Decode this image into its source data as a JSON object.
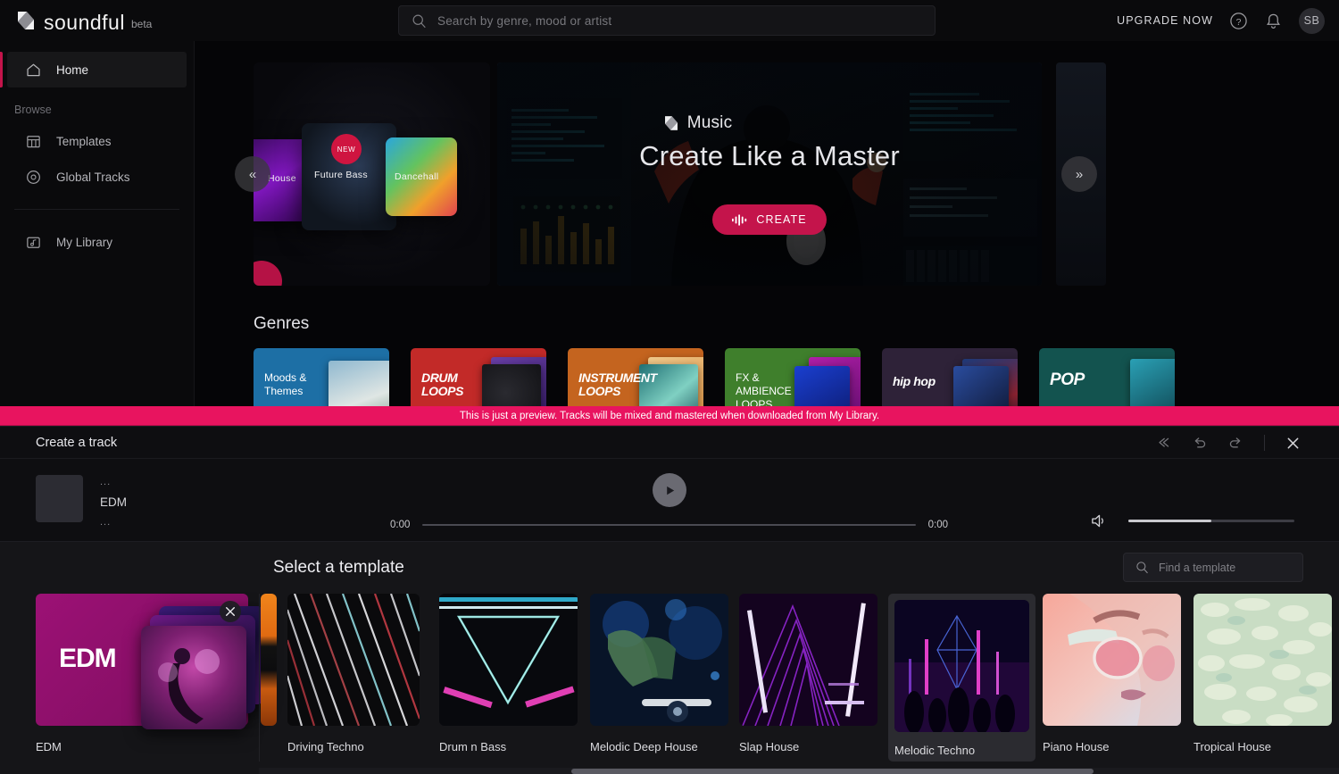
{
  "brand": {
    "name": "soundful",
    "tag": "beta"
  },
  "topbar": {
    "search_placeholder": "Search by genre, mood or artist",
    "upgrade_label": "UPGRADE NOW",
    "help_icon": "help-circle-icon",
    "bell_icon": "bell-icon",
    "avatar_initials": "SB"
  },
  "sidebar": {
    "section_label": "Browse",
    "items": [
      {
        "label": "Home",
        "icon": "home-icon",
        "active": true
      },
      {
        "label": "Templates",
        "icon": "grid-icon",
        "active": false
      },
      {
        "label": "Global Tracks",
        "icon": "disc-icon",
        "active": false
      },
      {
        "label": "My Library",
        "icon": "folder-music-icon",
        "active": false
      }
    ]
  },
  "hero": {
    "prev_arrow": "«",
    "next_arrow": "»",
    "side_card": {
      "new_badge": "NEW",
      "cards": [
        "House",
        "Future Bass",
        "Dancehall"
      ]
    },
    "brand_label": "Music",
    "title": "Create Like a Master",
    "cta_label": "CREATE",
    "cta_icon": "waveform-icon",
    "cta_color": "#c4144b"
  },
  "genres": {
    "title": "Genres",
    "cards": [
      {
        "name": "Moods & Themes",
        "color": "#1d6fa5",
        "style": "plain"
      },
      {
        "name": "DRUM LOOPS",
        "color": "#c22a28",
        "style": "stencil"
      },
      {
        "name": "INSTRUMENT LOOPS",
        "color": "#c4641f",
        "style": "stencil"
      },
      {
        "name": "FX & AMBIENCE LOOPS",
        "color": "#3f7f2c",
        "style": "plain"
      },
      {
        "name": "hip hop",
        "color": "#2e2238",
        "style": "stencil"
      },
      {
        "name": "POP",
        "color": "#13534f",
        "style": "stencil"
      }
    ]
  },
  "preview_banner": {
    "text": "This is just a preview. Tracks will be mixed and mastered when downloaded from My Library.",
    "color": "#e8145f"
  },
  "panel": {
    "title": "Create a track",
    "actions": [
      {
        "name": "reset-icon",
        "label": "Reset"
      },
      {
        "name": "undo-icon",
        "label": "Undo"
      },
      {
        "name": "redo-icon",
        "label": "Redo"
      },
      {
        "name": "close-icon",
        "label": "Close"
      }
    ],
    "player": {
      "track_title_placeholder": "...",
      "track_genre": "EDM",
      "track_sub_placeholder": "...",
      "current_time": "0:00",
      "total_time": "0:00",
      "play_icon": "play-icon",
      "volume_icon": "volume-icon",
      "volume_percent": 50,
      "progress_percent": 0
    },
    "templates": {
      "title": "Select a template",
      "search_placeholder": "Find a template",
      "selected": "EDM",
      "hovered": "Melodic Techno",
      "items": [
        {
          "label": "EDM",
          "selected": true
        },
        {
          "label": "Driving Techno",
          "selected": false
        },
        {
          "label": "Drum n Bass",
          "selected": false
        },
        {
          "label": "Melodic Deep House",
          "selected": false
        },
        {
          "label": "Slap House",
          "selected": false
        },
        {
          "label": "Melodic Techno",
          "selected": false
        },
        {
          "label": "Piano House",
          "selected": false
        },
        {
          "label": "Tropical House",
          "selected": false
        }
      ]
    }
  }
}
